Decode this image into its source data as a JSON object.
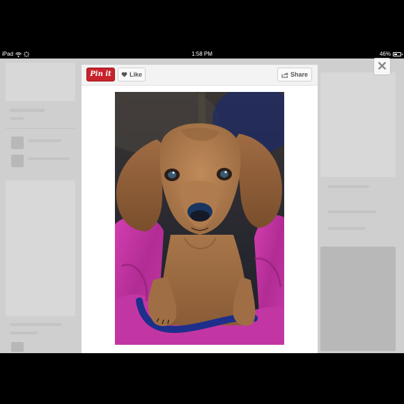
{
  "status_bar": {
    "device": "iPad",
    "time": "1:58 PM",
    "battery": "46%",
    "battery_level": 0.46
  },
  "pin_modal": {
    "pin_button_label": "Pin it",
    "like_button_label": "Like",
    "share_button_label": "Share",
    "close_glyph": "✕",
    "photo_subject": "dachshund puppy on a magenta blanket"
  },
  "icons": {
    "like": "heart-icon",
    "share": "share-arrow-icon",
    "close": "close-icon",
    "wifi": "wifi-icon",
    "activity": "activity-spinner-icon",
    "battery": "battery-icon"
  },
  "colors": {
    "pin_red": "#c8232c",
    "overlay_gray": "#cfcfcf",
    "blanket_magenta": "#c0309e"
  }
}
